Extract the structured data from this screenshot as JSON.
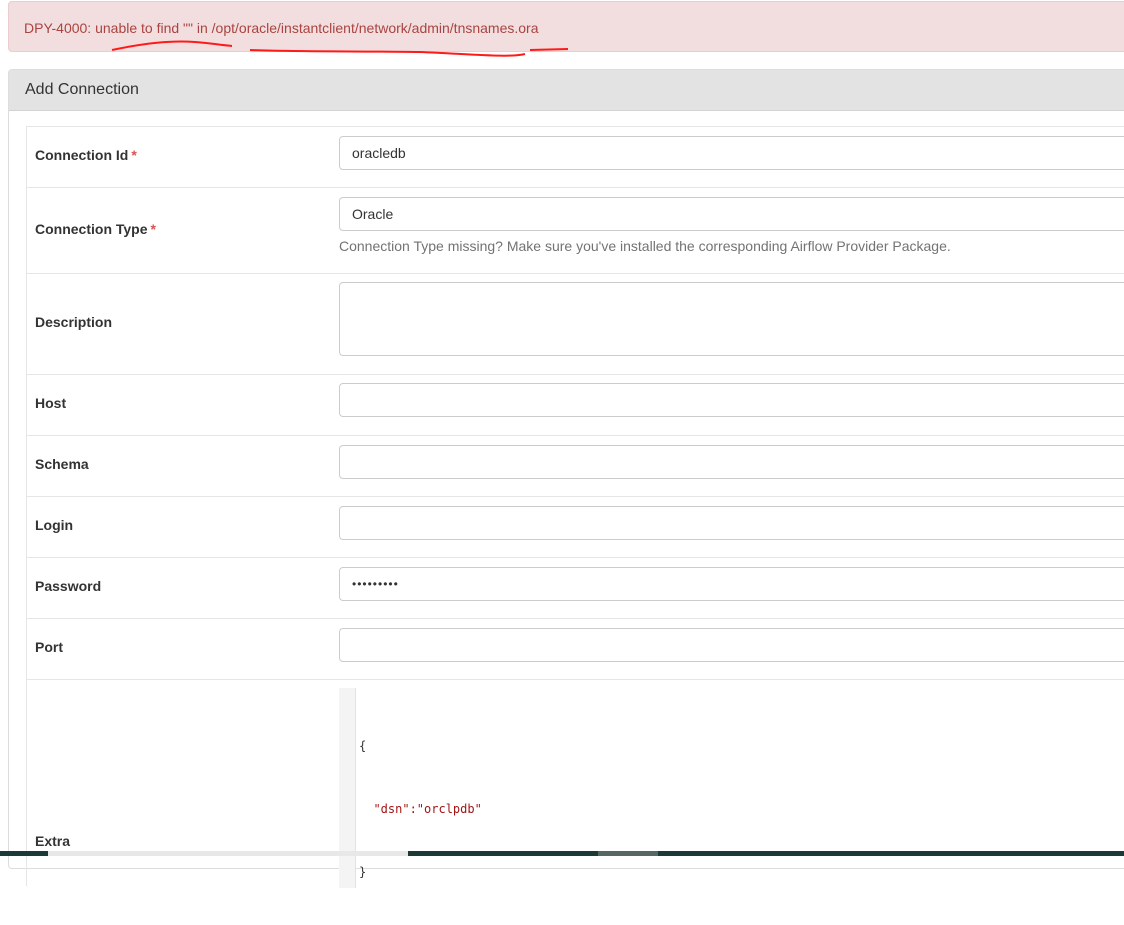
{
  "alert": {
    "message": "DPY-4000: unable to find \"\" in /opt/oracle/instantclient/network/admin/tnsnames.ora"
  },
  "panel": {
    "title": "Add Connection"
  },
  "form": {
    "required_mark": "*",
    "connection_id": {
      "label": "Connection Id",
      "value": "oracledb"
    },
    "connection_type": {
      "label": "Connection Type",
      "value": "Oracle",
      "help": "Connection Type missing? Make sure you've installed the corresponding Airflow Provider Package."
    },
    "description": {
      "label": "Description",
      "value": ""
    },
    "host": {
      "label": "Host",
      "value": ""
    },
    "schema": {
      "label": "Schema",
      "value": ""
    },
    "login": {
      "label": "Login",
      "value": ""
    },
    "password": {
      "label": "Password",
      "value": "•••••••••"
    },
    "port": {
      "label": "Port",
      "value": ""
    },
    "extra": {
      "label": "Extra",
      "lines": [
        "{",
        "  \"dsn\":\"orclpdb\"",
        "}"
      ]
    }
  },
  "colors": {
    "alert_text": "#a94442",
    "alert_bg": "#f2dede",
    "annotation_red": "#ff0000",
    "required": "#d9534f"
  }
}
